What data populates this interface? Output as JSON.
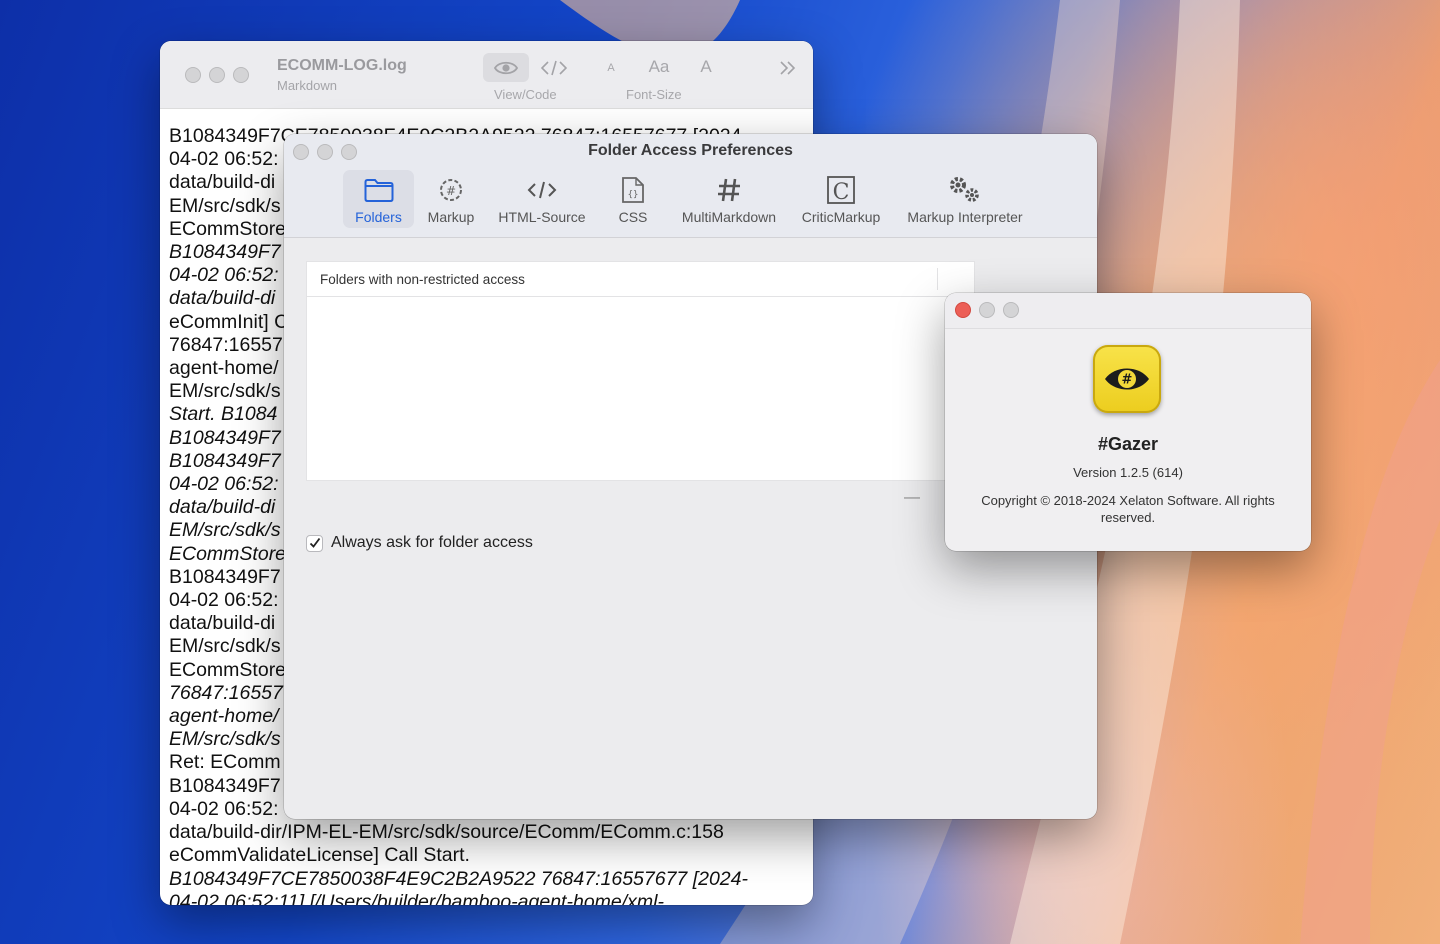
{
  "log_window": {
    "title": "ECOMM-LOG.log",
    "subtitle": "Markdown",
    "view_code_label": "View/Code",
    "font_size_label": "Font-Size",
    "font_small": "A",
    "font_aa": "Aa",
    "font_large": "A",
    "lines": [
      {
        "text": "B1084349F7CE7850038F4E9C2B2A9522 76847:16557677 [2024-",
        "italic": false
      },
      {
        "text": "04-02 06:52:",
        "italic": false
      },
      {
        "text": "data/build-di",
        "italic": false
      },
      {
        "text": "EM/src/sdk/s",
        "italic": false
      },
      {
        "text": "ECommStore",
        "italic": false
      },
      {
        "text": "B1084349F7",
        "italic": true
      },
      {
        "text": "04-02 06:52:",
        "italic": true
      },
      {
        "text": "data/build-di",
        "italic": true
      },
      {
        "text": "eCommInit] C",
        "italic": false
      },
      {
        "text": "76847:16557",
        "italic": false
      },
      {
        "text": "agent-home/",
        "italic": false
      },
      {
        "text": "EM/src/sdk/s",
        "italic": false
      },
      {
        "text": "Start. B1084",
        "italic": true
      },
      {
        "text": "B1084349F7",
        "italic": true
      },
      {
        "text": "B1084349F7",
        "italic": true
      },
      {
        "text": "04-02 06:52:",
        "italic": true
      },
      {
        "text": "data/build-di",
        "italic": true
      },
      {
        "text": "EM/src/sdk/s",
        "italic": true
      },
      {
        "text": "ECommStore",
        "italic": true
      },
      {
        "text": "B1084349F7",
        "italic": false
      },
      {
        "text": "04-02 06:52:",
        "italic": false
      },
      {
        "text": "data/build-di",
        "italic": false
      },
      {
        "text": "EM/src/sdk/s",
        "italic": false
      },
      {
        "text": "ECommStore",
        "italic": false
      },
      {
        "text": "76847:16557",
        "italic": true
      },
      {
        "text": "agent-home/",
        "italic": true
      },
      {
        "text": "EM/src/sdk/s",
        "italic": true
      },
      {
        "text": "Ret: EComm",
        "italic": false
      },
      {
        "text": "B1084349F7",
        "italic": false
      },
      {
        "text": "04-02 06:52:",
        "italic": false
      },
      {
        "text": "data/build-dir/IPM-EL-EM/src/sdk/source/EComm/EComm.c:158",
        "italic": false
      },
      {
        "text": "eCommValidateLicense] Call Start.",
        "italic": false
      },
      {
        "text": "B1084349F7CE7850038F4E9C2B2A9522 76847:16557677 [2024-",
        "italic": true
      },
      {
        "text": "04-02 06:52:11] [/Users/builder/bamboo-agent-home/xml-",
        "italic": true
      }
    ]
  },
  "prefs_window": {
    "title": "Folder Access Preferences",
    "tabs": [
      {
        "label": "Folders",
        "icon": "folder-icon",
        "active": true
      },
      {
        "label": "Markup",
        "icon": "markup-gear-icon",
        "active": false
      },
      {
        "label": "HTML-Source",
        "icon": "code-icon",
        "active": false
      },
      {
        "label": "CSS",
        "icon": "css-file-icon",
        "active": false
      },
      {
        "label": "MultiMarkdown",
        "icon": "hash-icon",
        "active": false
      },
      {
        "label": "CriticMarkup",
        "icon": "critic-c-icon",
        "active": false
      },
      {
        "label": "Markup Interpreter",
        "icon": "gears-icon",
        "active": false
      }
    ],
    "table_header": "Folders with non-restricted access",
    "remove_button": "—",
    "checkbox_label": "Always ask for folder access",
    "checkbox_checked": true
  },
  "about_window": {
    "app_name": "#Gazer",
    "version": "Version 1.2.5 (614)",
    "copyright": "Copyright © 2018-2024 Xelaton Software. All rights reserved.",
    "icon": "gazer-eye-icon"
  },
  "colors": {
    "accent": "#2563d9",
    "close_red": "#ec5f57",
    "app_icon_yellow": "#f3d93a"
  }
}
